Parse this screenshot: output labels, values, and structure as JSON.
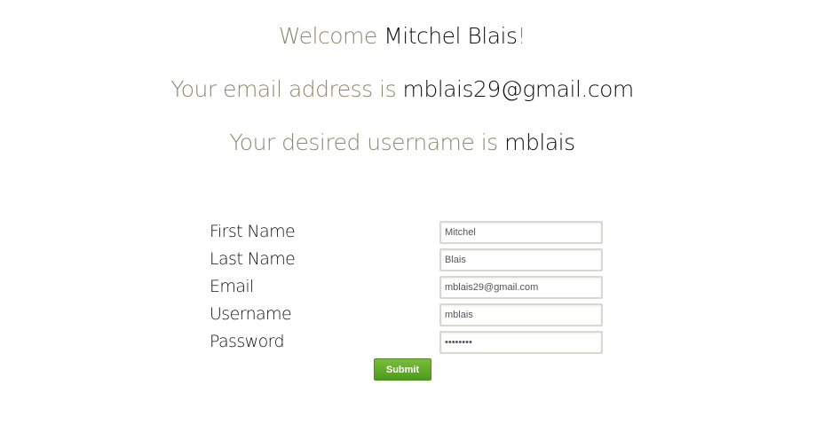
{
  "headings": {
    "welcome_prefix": "Welcome ",
    "welcome_name": "Mitchel Blais",
    "welcome_suffix": "!",
    "email_prefix": "Your email address is ",
    "email_value": "mblais29@gmail.com",
    "username_prefix": "Your desired username is ",
    "username_value": "mblais"
  },
  "form": {
    "first_name_label": "First Name",
    "first_name_value": "Mitchel",
    "last_name_label": "Last Name",
    "last_name_value": "Blais",
    "email_label": "Email",
    "email_value": "mblais29@gmail.com",
    "username_label": "Username",
    "username_value": "mblais",
    "password_label": "Password",
    "password_value": "••••••••",
    "submit_label": "Submit"
  },
  "colors": {
    "accent_green": "#5aa826",
    "heading_muted": "#8a8a6e",
    "text_dark": "#111111"
  }
}
